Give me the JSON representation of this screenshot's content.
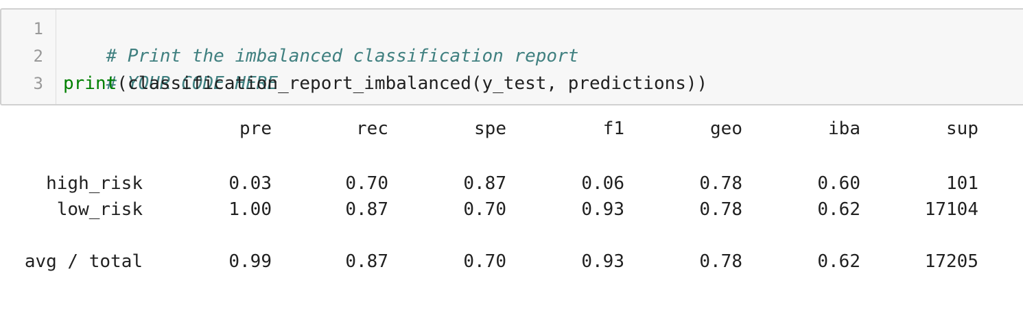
{
  "input_cell": {
    "line_numbers": [
      "1",
      "2",
      "3"
    ],
    "lines": {
      "comment1": "# Print the imbalanced classification report",
      "comment2": "# YOUR CODE HERE",
      "print_keyword": "print",
      "print_args": "(classification_report_imbalanced(y_test, predictions))"
    }
  },
  "output": {
    "headers": [
      "pre",
      "rec",
      "spe",
      "f1",
      "geo",
      "iba",
      "sup"
    ],
    "rows": [
      {
        "label": "high_risk",
        "values": [
          "0.03",
          "0.70",
          "0.87",
          "0.06",
          "0.78",
          "0.60",
          "101"
        ]
      },
      {
        "label": "low_risk",
        "values": [
          "1.00",
          "0.87",
          "0.70",
          "0.93",
          "0.78",
          "0.62",
          "17104"
        ]
      }
    ],
    "total": {
      "label": "avg / total",
      "values": [
        "0.99",
        "0.87",
        "0.70",
        "0.93",
        "0.78",
        "0.62",
        "17205"
      ]
    }
  },
  "colors": {
    "comment": "#408080",
    "builtin": "#008000",
    "text": "#212121",
    "line_number": "#999999"
  }
}
